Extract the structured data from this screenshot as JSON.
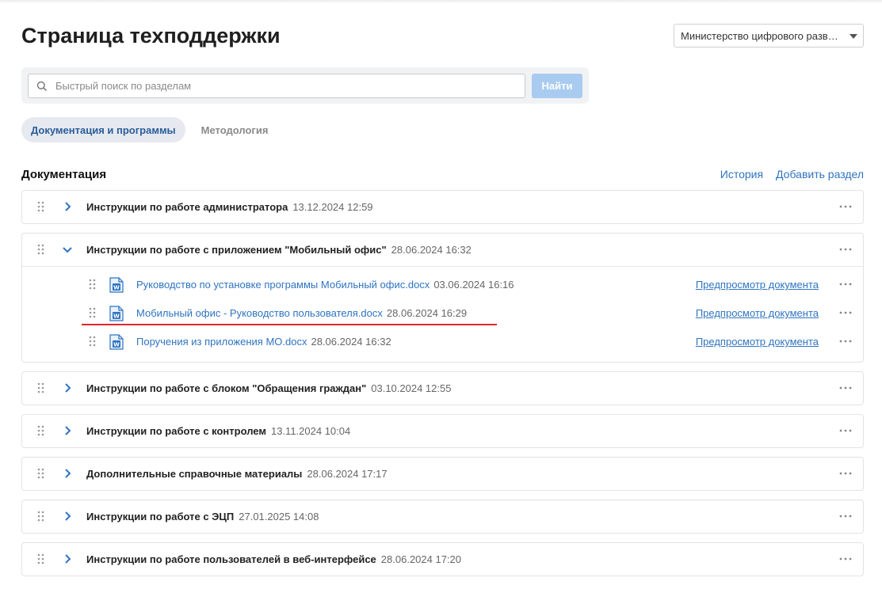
{
  "header": {
    "title": "Страница техподдержки",
    "org_select_value": "Министерство цифрового развития"
  },
  "search": {
    "placeholder": "Быстрый поиск по разделам",
    "button_label": "Найти"
  },
  "tabs": [
    {
      "label": "Документация и программы",
      "active": true
    },
    {
      "label": "Методология",
      "active": false
    }
  ],
  "section": {
    "title": "Документация",
    "history_label": "История",
    "add_section_label": "Добавить раздел"
  },
  "groups": [
    {
      "title": "Инструкции по работе администратора",
      "date": "13.12.2024 12:59",
      "expanded": false
    },
    {
      "title": "Инструкции по работе с приложением \"Мобильный офис\"",
      "date": "28.06.2024 16:32",
      "expanded": true,
      "documents": [
        {
          "name": "Руководство по установке программы Мобильный офис.docx",
          "date": "03.06.2024 16:16",
          "preview": "Предпросмотр документа"
        },
        {
          "name": "Мобильный офис - Руководство пользователя.docx",
          "date": "28.06.2024 16:29",
          "preview": "Предпросмотр документа"
        },
        {
          "name": "Поручения из приложения МО.docx",
          "date": "28.06.2024 16:32",
          "preview": "Предпросмотр документа"
        }
      ]
    },
    {
      "title": "Инструкции по работе с блоком \"Обращения граждан\"",
      "date": "03.10.2024 12:55",
      "expanded": false
    },
    {
      "title": "Инструкции по работе с контролем",
      "date": "13.11.2024 10:04",
      "expanded": false
    },
    {
      "title": "Дополнительные справочные материалы",
      "date": "28.06.2024 17:17",
      "expanded": false
    },
    {
      "title": "Инструкции по работе с ЭЦП",
      "date": "27.01.2025 14:08",
      "expanded": false
    },
    {
      "title": "Инструкции по работе пользователей в веб-интерфейсе",
      "date": "28.06.2024 17:20",
      "expanded": false
    }
  ],
  "colors": {
    "accent": "#2f74c0",
    "button_disabled": "#a9cbf0",
    "annotation_red": "#e5252a"
  }
}
